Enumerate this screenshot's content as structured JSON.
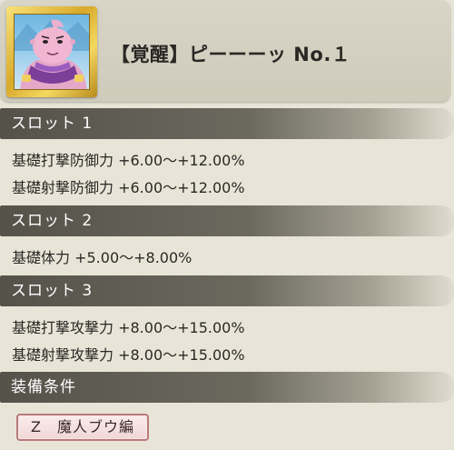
{
  "header": {
    "title": "【覚醒】ピーーーッ No.１",
    "portrait_icon": "majin-buu-portrait",
    "frame_color": "#d8a92a"
  },
  "sections": [
    {
      "label": "スロット 1",
      "rows": [
        "基礎打撃防御力 +6.00〜+12.00%",
        "基礎射撃防御力 +6.00〜+12.00%"
      ]
    },
    {
      "label": "スロット 2",
      "rows": [
        "基礎体力 +5.00〜+8.00%"
      ]
    },
    {
      "label": "スロット 3",
      "rows": [
        "基礎打撃攻撃力 +8.00〜+15.00%",
        "基礎射撃攻撃力 +8.00〜+15.00%"
      ]
    },
    {
      "label": "装備条件",
      "rows": []
    }
  ],
  "condition_badge": {
    "label": "Z　魔人ブウ編",
    "border_color": "#b97a7a"
  }
}
